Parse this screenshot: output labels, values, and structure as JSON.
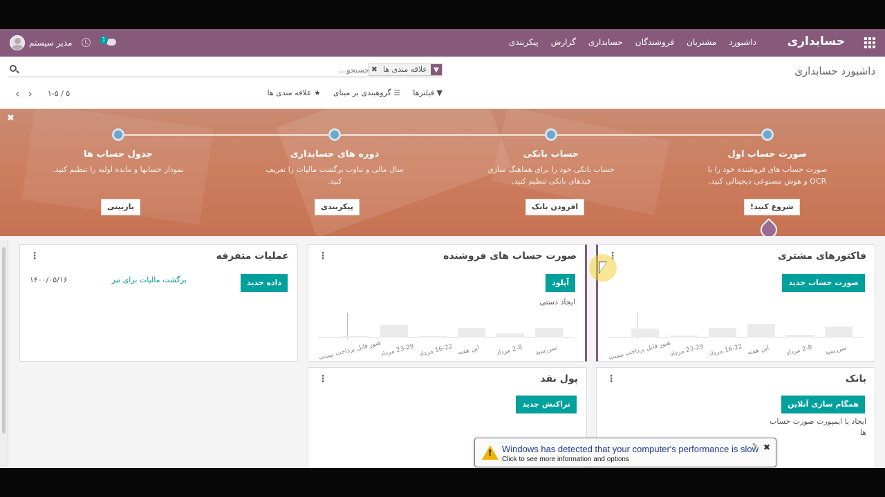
{
  "navbar": {
    "brand": "حسابداری",
    "menu": [
      "داشبورد",
      "مشتریان",
      "فروشندگان",
      "حسابداری",
      "گزارش",
      "پیکربندی"
    ],
    "user_name": "مدیر سیستم",
    "chat_badge": "1"
  },
  "control_panel": {
    "page_title": "داشبورد حسابداری",
    "search_placeholder": "جستجو...",
    "facet_value": "علاقه مندی ها",
    "filters_label": "فیلترها",
    "groupby_label": "گروهبندی بر مبنای",
    "favorites_label": "علاقه مندی ها",
    "pager_value": "۱-۵ / ۵"
  },
  "onboarding": {
    "steps": [
      {
        "title": "صورت حساب اول",
        "desc": "صورت حساب های فروشنده خود را با OCR و هوش مصنوعی دیجیتالی کنید.",
        "button": "شروع کنید!"
      },
      {
        "title": "حساب بانکی",
        "desc": "حساب بانکی خود را برای هماهنگ سازی فیدهای بانکی تنظیم کنید.",
        "button": "افزودن بانک"
      },
      {
        "title": "دوره های حسابداری",
        "desc": "سال مالی و تناوب برگشت مالیات را تعریف کنید.",
        "button": "پیکربندی"
      },
      {
        "title": "جدول حساب ها",
        "desc": "نمودار حسابها و مانده اولیه را تنظیم کنید.",
        "button": "بازبینی"
      }
    ]
  },
  "cards": {
    "customer_invoices": {
      "title": "فاکتورهای مشتری",
      "button": "صورت حساب جدید",
      "chart_labels": [
        "سررسید",
        "2-8 مرداد",
        "این هفته",
        "16-22 مرداد",
        "23-29 مرداد",
        "هنوز قابل پرداخت نیست"
      ],
      "chart_values": [
        0.45,
        0.12,
        0.55,
        0.4,
        0.08,
        0.35
      ]
    },
    "vendor_bills": {
      "title": "صورت حساب های فروشنده",
      "button": "آپلود",
      "manual_label": "ایجاد دستی",
      "chart_labels": [
        "سررسید",
        "2-8 مرداد",
        "این هفته",
        "16-22 مرداد",
        "23-29 مرداد",
        "هنوز قابل پرداخت نیست"
      ],
      "chart_values": [
        0.38,
        0.18,
        0.4,
        0.03,
        0.5,
        0.04
      ]
    },
    "misc": {
      "title": "عملیات متفرقه",
      "button": "داده جدید",
      "link": "برگشت مالیات برای تیر",
      "date": "۱۴۰۰/۰۵/۱۶"
    },
    "bank": {
      "title": "بانک",
      "button": "همگام سازی آنلاین",
      "sub": "ایجاد یا ایمپورت صورت حساب ها"
    },
    "cash": {
      "title": "پول نقد",
      "button": "تراکنش جدید"
    }
  },
  "toast": {
    "title": "Windows has detected that your computer's performance is slow",
    "sub": "Click to see more information and options"
  }
}
